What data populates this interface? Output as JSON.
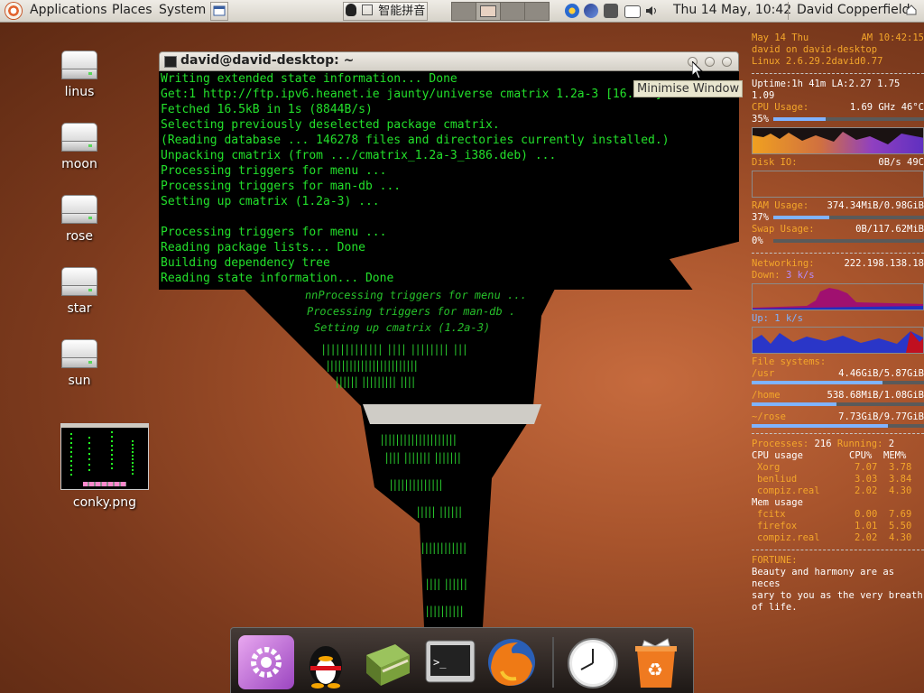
{
  "top_panel": {
    "menus": [
      "Applications",
      "Places",
      "System"
    ],
    "ime_label": "智能拼音",
    "clock": "Thu 14 May, 10:42",
    "user": "David Copperfield"
  },
  "desktop_icons": [
    {
      "label": "linus"
    },
    {
      "label": "moon"
    },
    {
      "label": "rose"
    },
    {
      "label": "star"
    },
    {
      "label": "sun"
    },
    {
      "label": "conky.png"
    }
  ],
  "terminal": {
    "title": "david@david-desktop: ~",
    "tooltip": "Minimise Window",
    "lines": [
      "Writing extended state information... Done",
      "Get:1 http://ftp.ipv6.heanet.ie jaunty/universe cmatrix 1.2a-3 [16.5kB]",
      "Fetched 16.5kB in 1s (8844B/s)",
      "Selecting previously deselected package cmatrix.",
      "(Reading database ... 146278 files and directories currently installed.)",
      "Unpacking cmatrix (from .../cmatrix_1.2a-3_i386.deb) ...",
      "Processing triggers for menu ...",
      "Processing triggers for man-db ...",
      "Setting up cmatrix (1.2a-3) ...",
      "",
      "Processing triggers for menu ...",
      "Reading package lists... Done",
      "Building dependency tree",
      "Reading state information... Done"
    ]
  },
  "conky": {
    "date": "May  14  Thu",
    "time": "AM 10:42:15",
    "host_line": "david on david-desktop",
    "kernel": "Linux 2.6.29.2david0.77",
    "uptime": "Uptime:1h 41m LA:2.27 1.75 1.09",
    "cpu_label": "CPU Usage:",
    "cpu_freq": "1.69 GHz 46°C",
    "cpu_pct": "35%",
    "cpu_fraction": 0.35,
    "disk_label": "Disk IO:",
    "disk_value": "0B/s 49C",
    "ram_label": "RAM Usage:",
    "ram_value": "374.34MiB/0.98GiB",
    "ram_pct": "37%",
    "ram_fraction": 0.37,
    "swap_label": "Swap Usage:",
    "swap_value": "0B/117.62MiB",
    "swap_pct": "0%",
    "net_label": "Networking:",
    "net_ip": "222.198.138.18",
    "down_label": "Down:",
    "down_value": "3 k/s",
    "up_label": "Up:",
    "up_value": "1 k/s",
    "fs_label": "File systems:",
    "filesystems": [
      {
        "mount": "/usr",
        "value": "4.46GiB/5.87GiB",
        "fraction": 0.76
      },
      {
        "mount": "/home",
        "value": "538.68MiB/1.08GiB",
        "fraction": 0.49
      },
      {
        "mount": "~/rose",
        "value": "7.73GiB/9.77GiB",
        "fraction": 0.79
      }
    ],
    "processes_label": "Processes:",
    "processes_value": "216",
    "running_label": "Running:",
    "running_value": "2",
    "cpu_usage_header": "CPU usage",
    "cpu_col": "CPU%",
    "mem_col": "MEM%",
    "cpu_procs": [
      {
        "name": "Xorg",
        "cpu": "7.07",
        "mem": "3.78"
      },
      {
        "name": "benliud",
        "cpu": "3.03",
        "mem": "3.84"
      },
      {
        "name": "compiz.real",
        "cpu": "2.02",
        "mem": "4.30"
      }
    ],
    "mem_usage_header": "Mem usage",
    "mem_procs": [
      {
        "name": "fcitx",
        "cpu": "0.00",
        "mem": "7.69"
      },
      {
        "name": "firefox",
        "cpu": "1.01",
        "mem": "5.50"
      },
      {
        "name": "compiz.real",
        "cpu": "2.02",
        "mem": "4.30"
      }
    ],
    "fortune_label": "FORTUNE:",
    "fortune_lines": [
      "Beauty and harmony are as neces",
      "sary to you as the very breath",
      "of life."
    ]
  },
  "dock": {
    "items": [
      {
        "icon": "settings-icon"
      },
      {
        "icon": "qq-penguin-icon"
      },
      {
        "icon": "book-icon"
      },
      {
        "icon": "terminal-icon"
      },
      {
        "icon": "firefox-icon"
      },
      {
        "icon": "clock-icon"
      },
      {
        "icon": "trash-icon"
      }
    ]
  }
}
